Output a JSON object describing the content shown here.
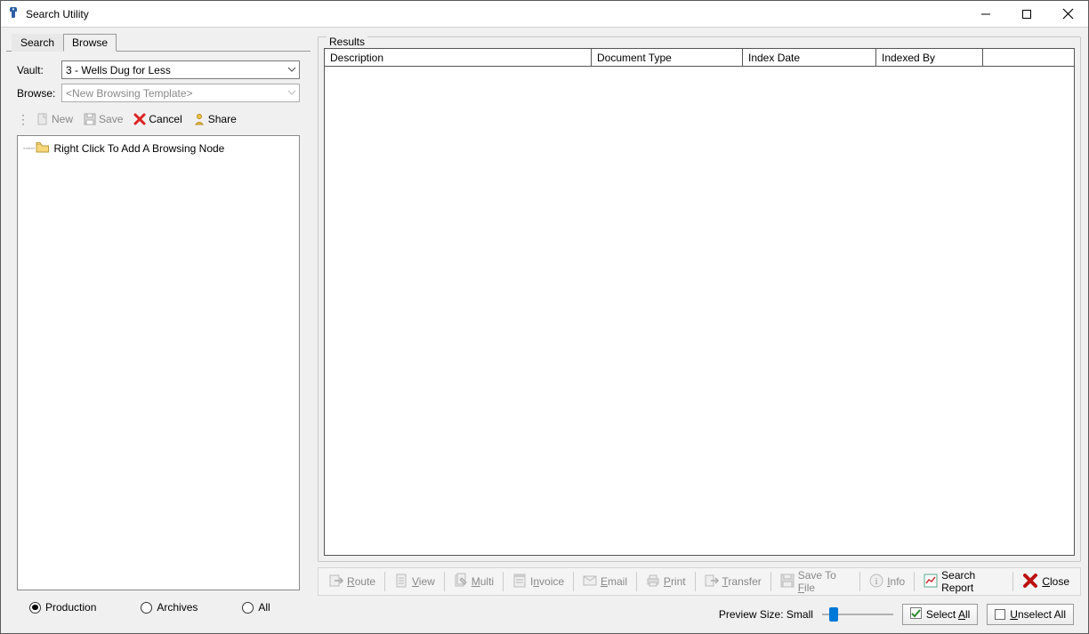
{
  "window": {
    "title": "Search Utility"
  },
  "tabs": {
    "search": "Search",
    "browse": "Browse",
    "active": "browse"
  },
  "form": {
    "vault_label": "Vault:",
    "vault_value": "3 - Wells Dug for Less",
    "browse_label": "Browse:",
    "browse_value": "<New Browsing Template>"
  },
  "toolbar": {
    "new": "New",
    "save": "Save",
    "cancel": "Cancel",
    "share": "Share"
  },
  "tree": {
    "hint": "Right Click To Add A Browsing Node"
  },
  "radios": {
    "production": "Production",
    "archives": "Archives",
    "all": "All",
    "selected": "production"
  },
  "results": {
    "label": "Results",
    "columns": [
      "Description",
      "Document Type",
      "Index Date",
      "Indexed By"
    ]
  },
  "actions": {
    "route": "Route",
    "view": "View",
    "multi": "Multi",
    "invoice": "Invoice",
    "email": "Email",
    "print": "Print",
    "transfer": "Transfer",
    "save_to_file": "Save To File",
    "info": "Info",
    "search_report": "Search Report",
    "close": "Close"
  },
  "footer": {
    "preview_label": "Preview Size: Small",
    "select_all": "Select All",
    "unselect_all": "Unselect All"
  }
}
